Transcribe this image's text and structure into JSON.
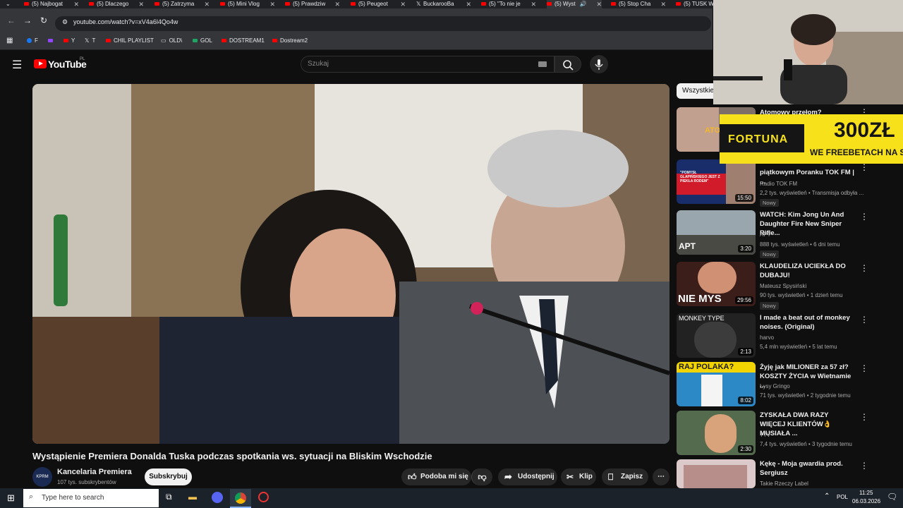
{
  "browser": {
    "tabs": [
      {
        "label": "(5) Najbogat"
      },
      {
        "label": "(5) Dlaczego"
      },
      {
        "label": "(5) Zatrzyma"
      },
      {
        "label": "(5) Mini Vlog"
      },
      {
        "label": "(5) Prawdziw"
      },
      {
        "label": "(5) Peugeot"
      },
      {
        "label": "BuckarooBa"
      },
      {
        "label": "(5) \"To nie je"
      },
      {
        "label": "(5) Wyst"
      },
      {
        "label": "(5) Stop Cha"
      },
      {
        "label": "(5) TUSK W"
      }
    ],
    "url": "youtube.com/watch?v=xV4a6l4Qo4w",
    "bookmarks": [
      "F",
      "Y",
      "T",
      "CHIL PLAYLIST",
      "OLD\\",
      "GOL",
      "DOSTREAM1",
      "Dostream2"
    ]
  },
  "youtube": {
    "logo_text": "YouTube",
    "region": "PL",
    "search_placeholder": "Szukaj",
    "video_title": "Wystąpienie Premiera Donalda Tuska podczas spotkania ws. sytuacji na Bliskim Wschodzie",
    "channel_name": "Kancelaria Premiera",
    "channel_avatar_text": "KPRM",
    "subscribers": "107 tys. subskrybentów",
    "subscribe_label": "Subskrybuj",
    "actions": {
      "like": "Podoba mi się",
      "share": "Udostępnij",
      "clip": "Klip",
      "save": "Zapisz"
    },
    "chips": [
      "Wszystkie"
    ],
    "recommendations": [
      {
        "title": "Atomowy przełom? Francuski",
        "channel": "",
        "meta": "",
        "badge": "",
        "duration": "",
        "thumb_text": "ATO"
      },
      {
        "title": "piątkowym Poranku TOK FM | ...",
        "channel": "Radio TOK FM",
        "meta": "2,2 tys. wyświetleń • Transmisja odbyła ...",
        "badge": "Nowy",
        "duration": "15:50",
        "thumb_text": "\"POMYSŁ GLAPIŃSKIEGO JEST Z PIEKŁA RODEM\""
      },
      {
        "title": "WATCH: Kim Jong Un And Daughter Fire New Sniper Rifle...",
        "channel": "APT",
        "meta": "888 tys. wyświetleń • 6 dni temu",
        "badge": "Nowy",
        "duration": "3:20",
        "thumb_text": "APT"
      },
      {
        "title": "KLAUDELIZA UCIEKŁA DO DUBAJU!",
        "channel": "Mateusz Spysiński",
        "meta": "90 tys. wyświetleń • 1 dzień temu",
        "badge": "Nowy",
        "duration": "29:56",
        "thumb_text": "NIE MYS"
      },
      {
        "title": "I made a beat out of monkey noises. (Original)",
        "channel": "harvo",
        "meta": "5,4 mln wyświetleń • 5 lat temu",
        "badge": "",
        "duration": "2:13",
        "thumb_text": "MONKEY TYPE"
      },
      {
        "title": "Żyję jak MILIONER za 57 zł? KOSZTY ŻYCIA w Wietnamie ...",
        "channel": "Łysy Gringo",
        "meta": "71 tys. wyświetleń • 2 tygodnie temu",
        "badge": "",
        "duration": "8:02",
        "thumb_text": "RAJ POLAKA?"
      },
      {
        "title": "ZYSKAŁA DWA RAZY WIĘCEJ KLIENTÓW👌 MUSIAŁA ...",
        "channel": "TTV",
        "meta": "7,4 tys. wyświetleń • 3 tygodnie temu",
        "badge": "",
        "duration": "2:30",
        "thumb_text": ""
      },
      {
        "title": "Kękę - Moja gwardia prod. Sergiusz",
        "channel": "Takie Rzeczy Label",
        "meta": "",
        "badge": "",
        "duration": "",
        "thumb_text": ""
      }
    ]
  },
  "overlays": {
    "ad_brand": "FORTUNA",
    "ad_amount": "300ZŁ",
    "ad_sub": "WE FREEBETACH NA STAR"
  },
  "taskbar": {
    "search_placeholder": "Type here to search",
    "language": "POL",
    "time": "11:25",
    "date": "06.03.2026"
  }
}
